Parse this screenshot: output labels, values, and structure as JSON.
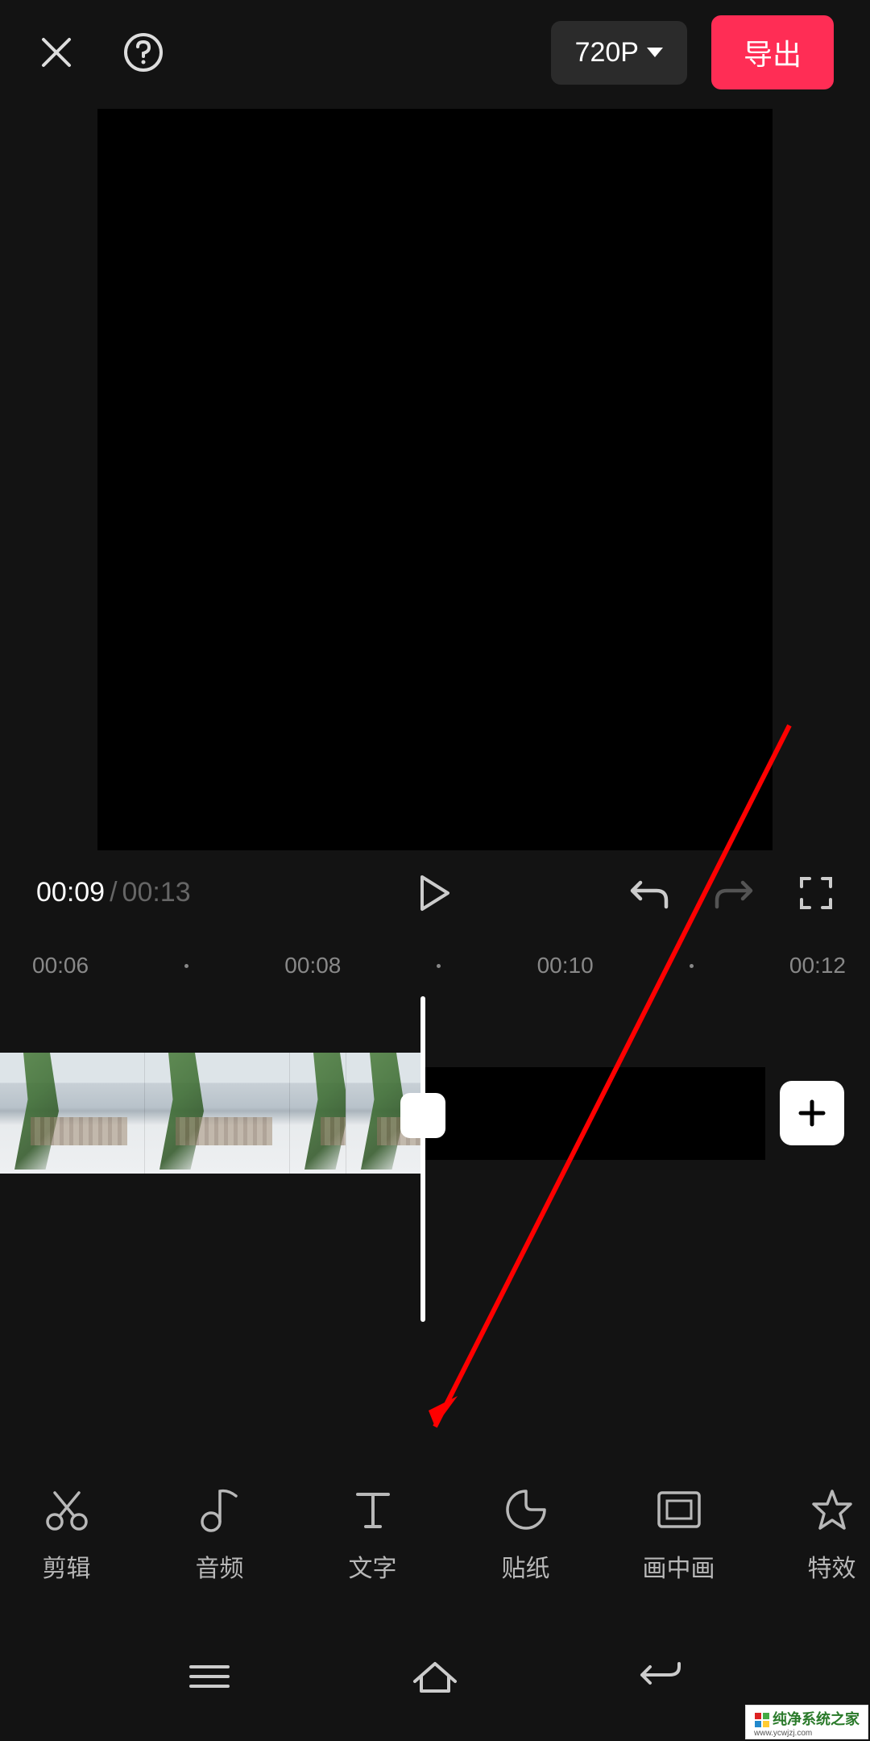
{
  "header": {
    "resolution": "720P",
    "export_label": "导出"
  },
  "controls": {
    "current_time": "00:09",
    "total_time": "00:13"
  },
  "ruler": {
    "ticks": [
      "00:06",
      "00:08",
      "00:10",
      "00:12"
    ]
  },
  "toolbar": {
    "items": [
      {
        "label": "剪辑",
        "icon": "edit"
      },
      {
        "label": "音频",
        "icon": "audio"
      },
      {
        "label": "文字",
        "icon": "text"
      },
      {
        "label": "贴纸",
        "icon": "sticker"
      },
      {
        "label": "画中画",
        "icon": "pip"
      },
      {
        "label": "特效",
        "icon": "effects"
      }
    ]
  },
  "watermark": {
    "text": "纯净系统之家",
    "url": "www.ycwjzj.com"
  }
}
